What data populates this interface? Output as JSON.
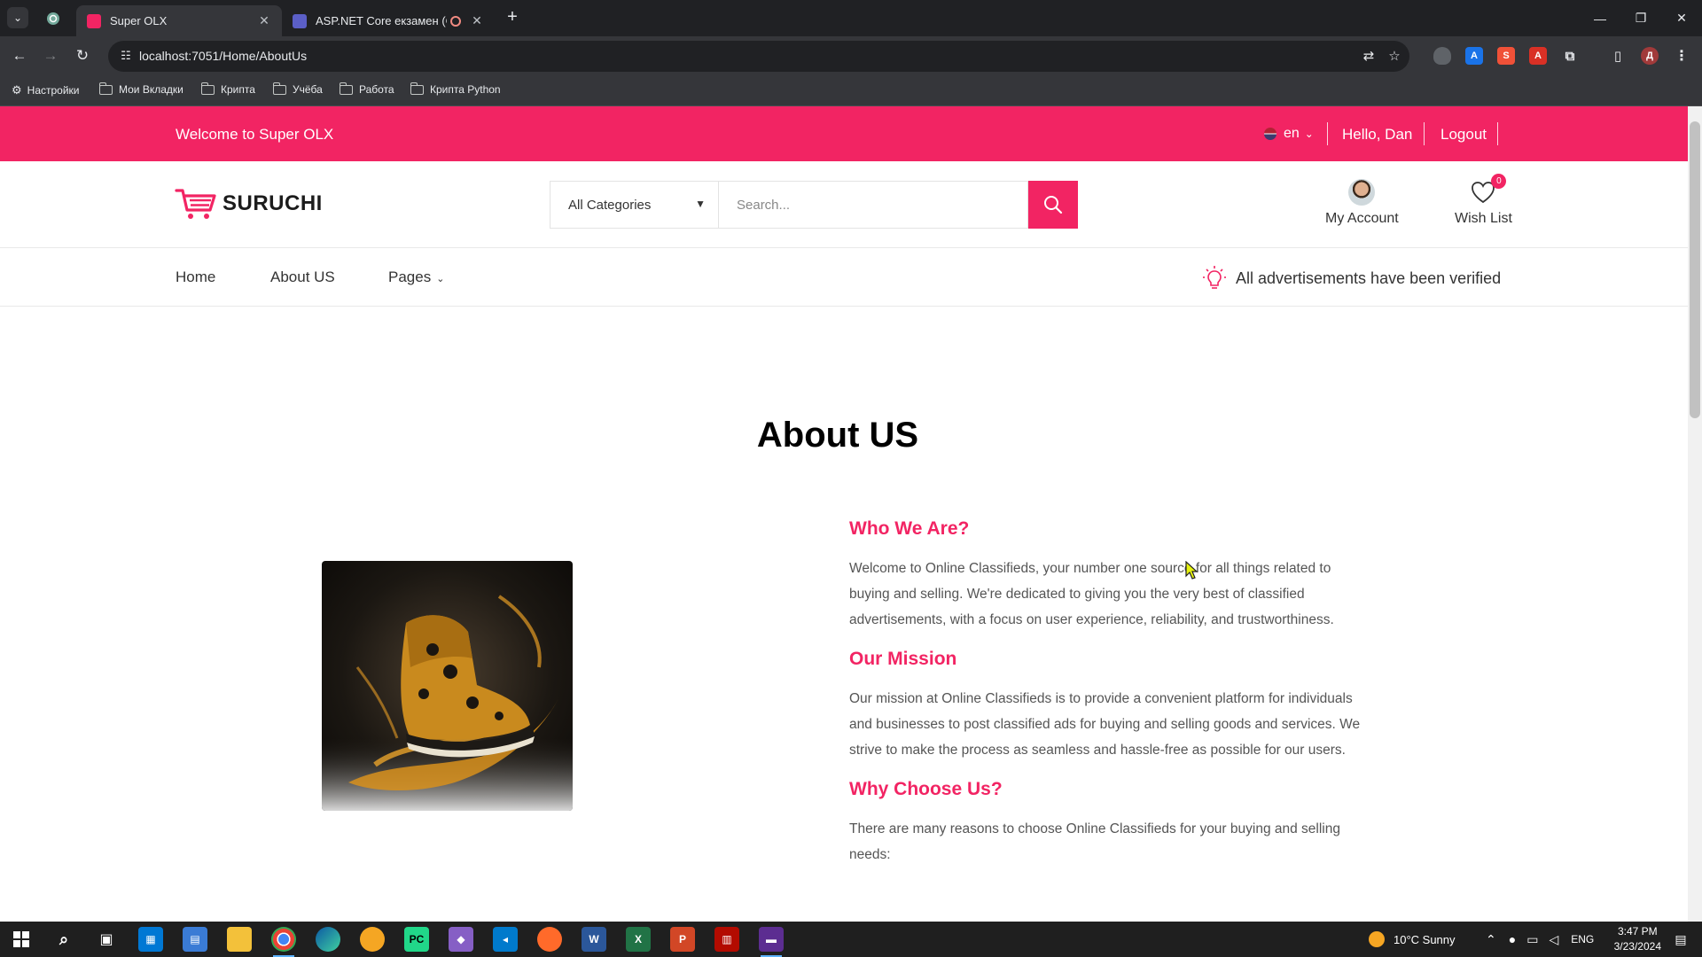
{
  "browser": {
    "tabs": [
      {
        "title": "Super OLX",
        "active": true
      },
      {
        "title": "ASP.NET Core екзамен (Co",
        "active": false
      }
    ],
    "url": "localhost:7051/Home/AboutUs",
    "bookmarks": [
      "Настройки",
      "Мои Вкладки",
      "Крипта",
      "Учёба",
      "Работа",
      "Крипта Python"
    ]
  },
  "topbar": {
    "welcome": "Welcome to Super OLX",
    "lang": "en",
    "greeting": "Hello, Dan",
    "logout": "Logout"
  },
  "header": {
    "logo": "SURUCHI",
    "category": "All Categories",
    "search_placeholder": "Search...",
    "account": "My Account",
    "wishlist": "Wish List",
    "wishlist_count": "0"
  },
  "nav": {
    "items": [
      "Home",
      "About US",
      "Pages"
    ],
    "notice": "All advertisements have been verified"
  },
  "about": {
    "title": "About US",
    "sections": [
      {
        "heading": "Who We Are?",
        "text": "Welcome to Online Classifieds, your number one source for all things related to buying and selling. We're dedicated to giving you the very best of classified advertisements, with a focus on user experience, reliability, and trustworthiness."
      },
      {
        "heading": "Our Mission",
        "text": "Our mission at Online Classifieds is to provide a convenient platform for individuals and businesses to post classified ads for buying and selling goods and services. We strive to make the process as seamless and hassle-free as possible for our users."
      },
      {
        "heading": "Why Choose Us?",
        "text": "There are many reasons to choose Online Classifieds for your buying and selling needs:"
      }
    ]
  },
  "taskbar": {
    "weather": "10°C  Sunny",
    "lang": "ENG",
    "time": "3:47 PM",
    "date": "3/23/2024"
  },
  "colors": {
    "accent": "#f22463",
    "chrome_dark": "#202124",
    "chrome_mid": "#35363a"
  }
}
